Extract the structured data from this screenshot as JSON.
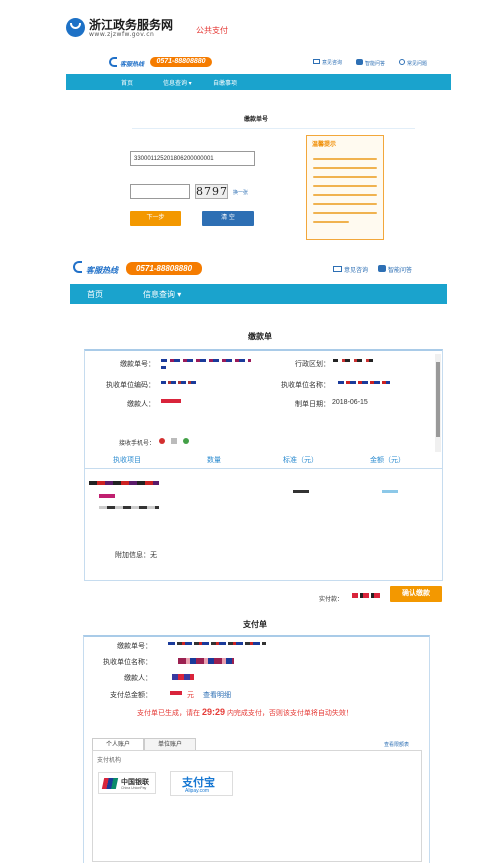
{
  "site": {
    "title": "浙江政务服务网",
    "url": "www.zjzwfw.gov.cn",
    "section_tag": "公共支付"
  },
  "support": {
    "hotline_label": "客服热线",
    "hotline_number": "0571-88808880",
    "links": [
      "意见咨询",
      "智能问答",
      "常见问题"
    ]
  },
  "nav": {
    "home": "首页",
    "query": "信息查询",
    "self_service": "自缴事项"
  },
  "query_form": {
    "title": "缴款单号",
    "number_value": "330001125201806200000001",
    "captcha_placeholder": "",
    "captcha_text": "8797",
    "refresh_link": "换一张",
    "next_button": "下一步",
    "clear_button": "清 空",
    "tip_title": "温馨提示"
  },
  "bill": {
    "title": "缴款单",
    "labels": {
      "bill_no": "缴款单号：",
      "region": "行政区划：",
      "unit_code": "执收单位编码：",
      "unit_name": "执收单位名称：",
      "payer": "缴款人：",
      "date": "制单日期："
    },
    "date_value": "2018-06-15",
    "phone_label": "接收手机号：",
    "columns": [
      "执收项目",
      "数量",
      "标准（元）",
      "金额（元）"
    ],
    "extra_label": "附加信息：",
    "extra_value": "无",
    "paid_label": "实付款：",
    "confirm_button": "确认缴款"
  },
  "payment": {
    "title": "支付单",
    "labels": {
      "bill_no": "缴款单号：",
      "unit_name": "执收单位名称：",
      "payer": "缴款人：",
      "total": "支付总金额："
    },
    "total_suffix": "元",
    "view_detail": "查看明细",
    "status_prefix": "支付单已生成，请在",
    "status_time": "29:29",
    "status_suffix": "内完成支付，否则该支付单将自动失效！",
    "tabs": [
      "个人账户",
      "单位账户"
    ],
    "limit_link": "查看限额表",
    "org_label": "支付机构",
    "unionpay_cn": "中国银联",
    "unionpay_en": "China UnionPay",
    "alipay_cn": "支付宝",
    "alipay_en": "Alipay.com"
  },
  "colors": {
    "nav": "#1aa3cd",
    "orange": "#f39800",
    "blue": "#2d6fb4",
    "red": "#e53935"
  }
}
